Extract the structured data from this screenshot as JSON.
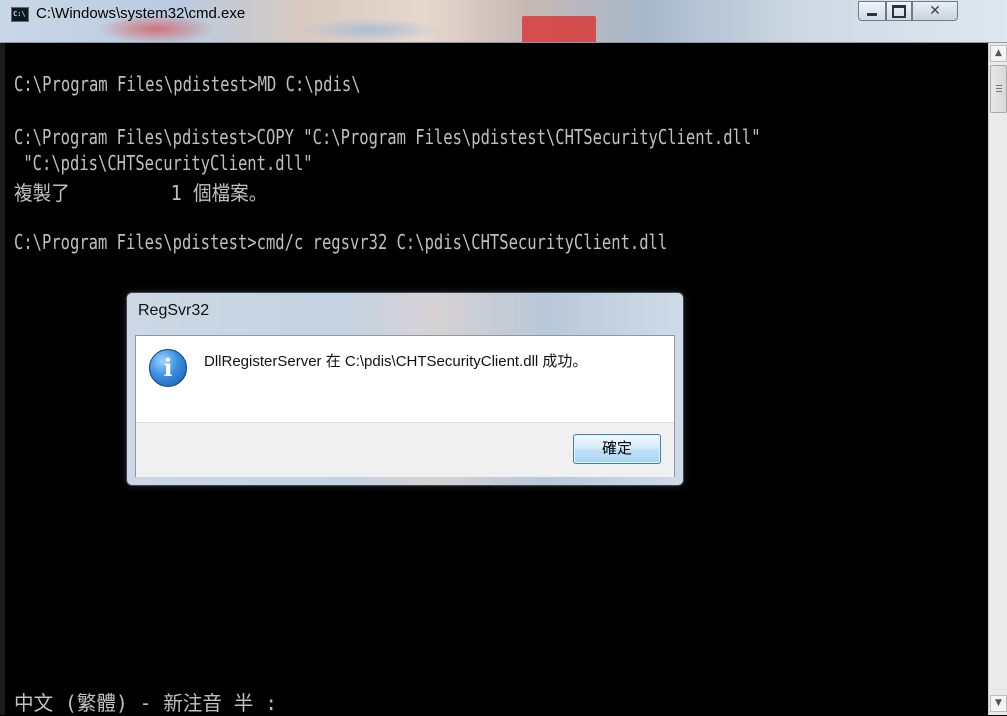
{
  "window": {
    "title": "C:\\Windows\\system32\\cmd.exe",
    "icon": "cmd-icon",
    "icon_text": "C:\\"
  },
  "console": {
    "lines": [
      "C:\\Program Files\\pdistest>MD C:\\pdis\\",
      "C:\\Program Files\\pdistest>COPY \"C:\\Program Files\\pdistest\\CHTSecurityClient.dll\"",
      " \"C:\\pdis\\CHTSecurityClient.dll\"",
      "複製了         1 個檔案。",
      "C:\\Program Files\\pdistest>cmd/c regsvr32 C:\\pdis\\CHTSecurityClient.dll",
      "中文 (繁體) - 新注音 半 :"
    ],
    "text_color": "#c0c0c0",
    "background": "#000000"
  },
  "dialog": {
    "title": "RegSvr32",
    "message": "DllRegisterServer 在 C:\\pdis\\CHTSecurityClient.dll 成功。",
    "ok_label": "確定",
    "icon": "info-icon"
  }
}
